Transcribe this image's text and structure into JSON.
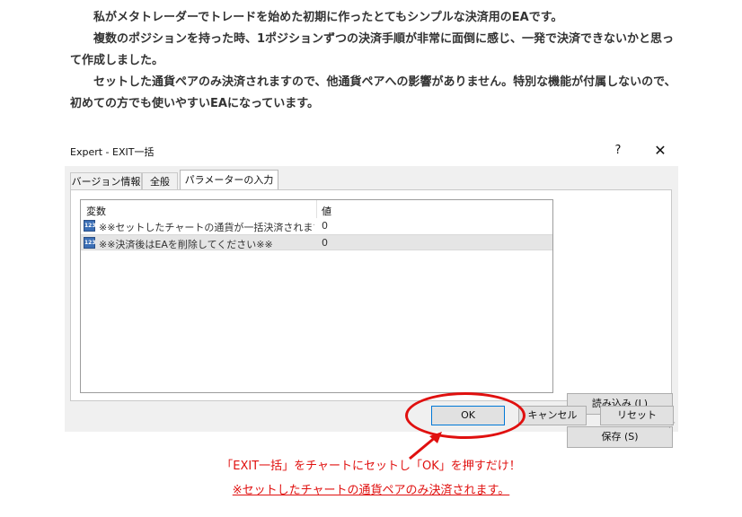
{
  "article": {
    "p1": "私がメタトレーダーでトレードを始めた初期に作ったとてもシンプルな決済用のEAです。",
    "p2": "複数のポジションを持った時、1ポジションずつの決済手順が非常に面倒に感じ、一発で決済できないかと思って作成しました。",
    "p3": "セットした通貨ペアのみ決済されますので、他通貨ペアへの影響がありません。特別な機能が付属しないので、初めての方でも使いやすいEAになっています。"
  },
  "dialog": {
    "title": "Expert - EXIT一括",
    "help_label": "?",
    "close_label": "✕",
    "tabs": [
      {
        "label": "バージョン情報"
      },
      {
        "label": "全般"
      },
      {
        "label": "パラメーターの入力",
        "active": true
      }
    ],
    "table": {
      "headers": [
        "変数",
        "値"
      ],
      "rows": [
        {
          "icon": "123-icon",
          "name": "※※セットしたチャートの通貨が一括決済されます...",
          "value": "0"
        },
        {
          "icon": "123-icon",
          "name": "※※決済後はEAを削除してください※※",
          "value": "0"
        }
      ]
    },
    "buttons": {
      "load": "読み込み (L)",
      "save": "保存 (S)",
      "ok": "OK",
      "cancel": "キャンセル",
      "reset": "リセット"
    }
  },
  "annotation": {
    "line1": "「EXIT一括」をチャートにセットし「OK」を押すだけ！",
    "line2": "※セットしたチャートの通貨ペアのみ決済されます。",
    "color": "#e0100f"
  }
}
